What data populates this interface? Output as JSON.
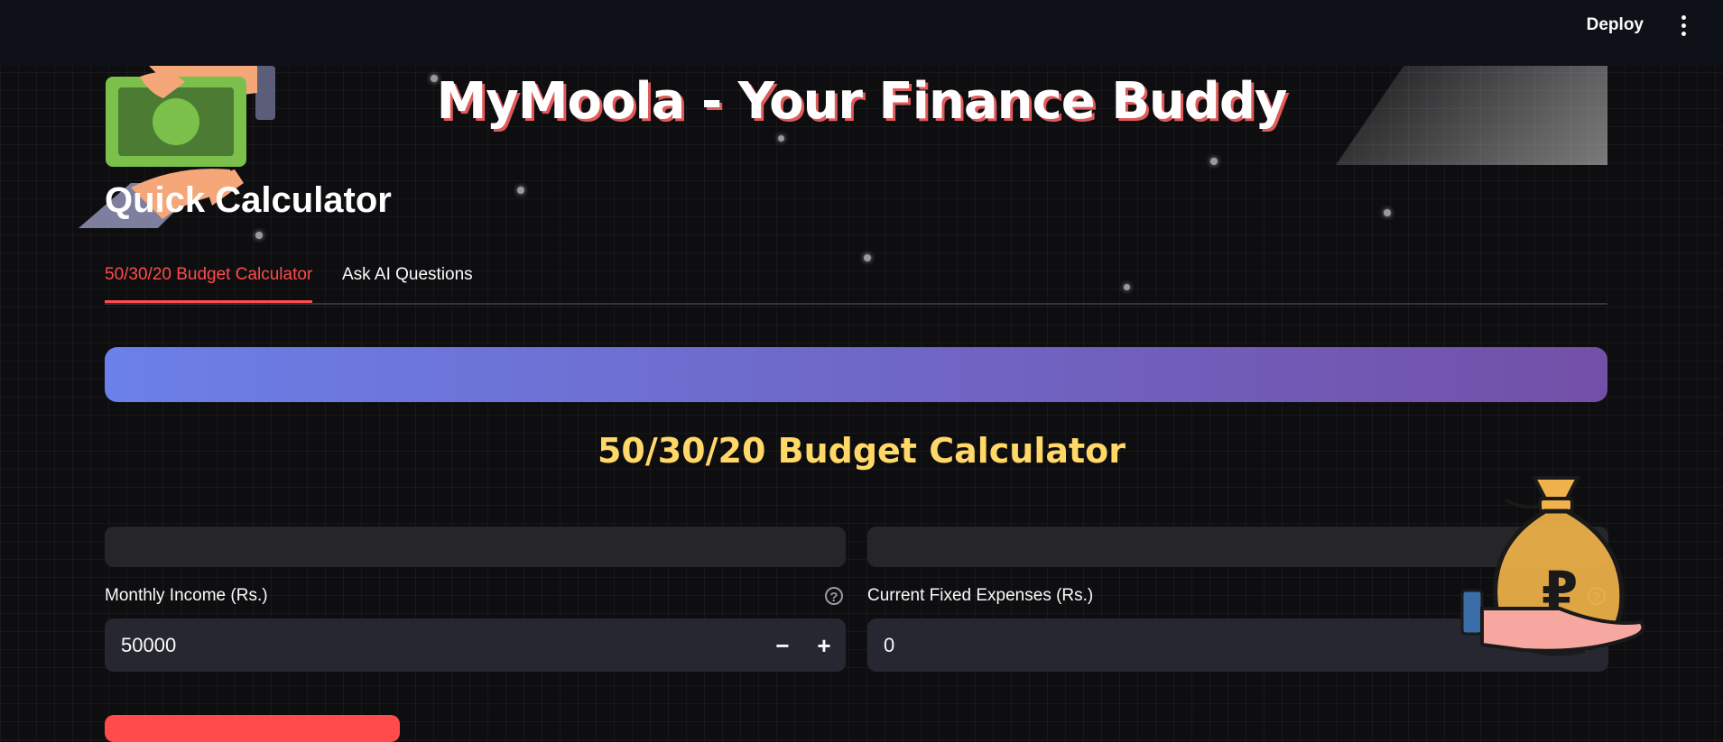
{
  "header": {
    "deploy_label": "Deploy",
    "menu_icon": "kebab-menu-icon"
  },
  "app": {
    "title": "MyMoola - Your Finance Buddy",
    "section_title": "Quick Calculator"
  },
  "tabs": [
    {
      "label": "50/30/20 Budget Calculator",
      "active": true
    },
    {
      "label": "Ask AI Questions",
      "active": false
    }
  ],
  "calculator": {
    "heading": "50/30/20 Budget Calculator",
    "fields": [
      {
        "label": "Monthly Income (Rs.)",
        "value": "50000",
        "help_icon": "help-circle-icon"
      },
      {
        "label": "Current Fixed Expenses (Rs.)",
        "value": "0",
        "help_icon": "help-circle-icon"
      }
    ],
    "stepper": {
      "minus": "−",
      "plus": "+"
    }
  },
  "colors": {
    "accent": "#ff4b4b",
    "heading_yellow": "#ffd867",
    "banner_start": "#6b80e8",
    "banner_end": "#7350a8"
  }
}
